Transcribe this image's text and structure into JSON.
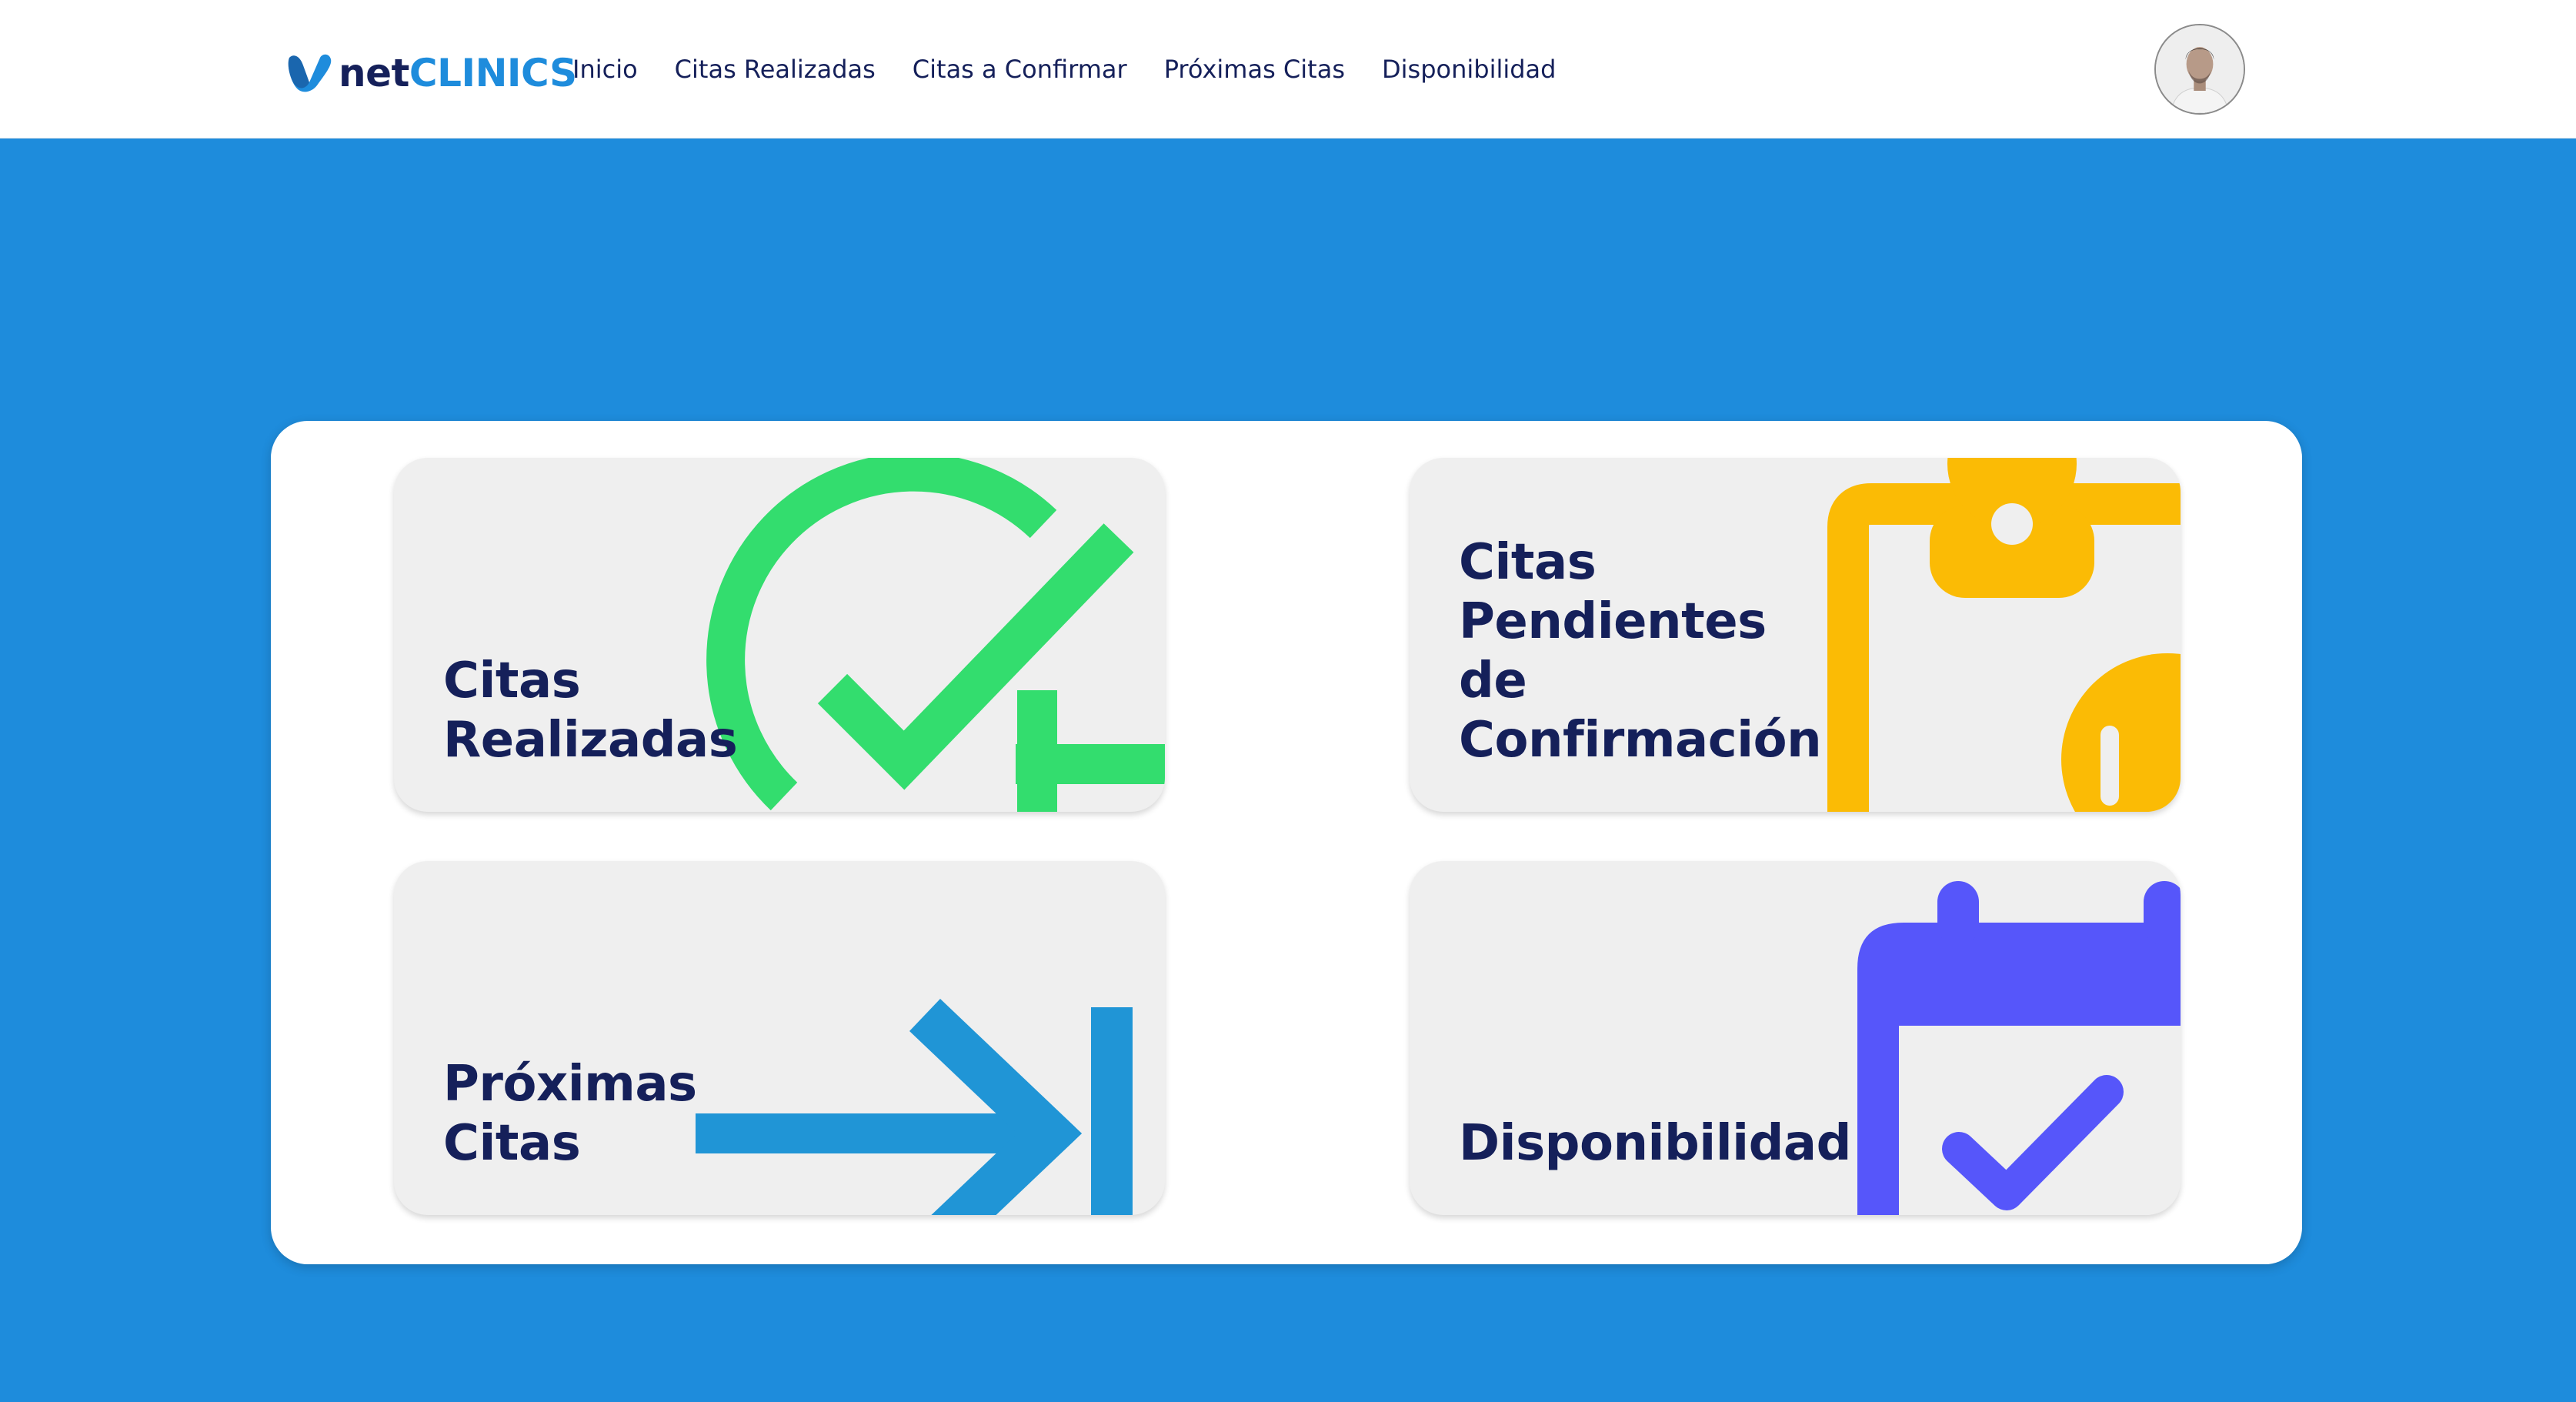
{
  "brand": {
    "name_part1": "net",
    "name_part2": "CLINICS",
    "colors": {
      "navy": "#15205a",
      "blue": "#1e8cdc"
    }
  },
  "nav": {
    "items": [
      {
        "label": "Inicio"
      },
      {
        "label": "Citas Realizadas"
      },
      {
        "label": "Citas a Confirmar"
      },
      {
        "label": "Próximas Citas"
      },
      {
        "label": "Disponibilidad"
      }
    ]
  },
  "user": {
    "avatar_icon": "user-avatar"
  },
  "cards": [
    {
      "title": "Citas\nRealizadas",
      "icon": "check-circle-plus-icon",
      "color": "#33dd6e"
    },
    {
      "title": "Citas\nPendientes\nde\nConfirmación",
      "icon": "clipboard-clock-icon",
      "color": "#fbbb05"
    },
    {
      "title": "Próximas\nCitas",
      "icon": "arrow-right-bar-icon",
      "color": "#2095d6"
    },
    {
      "title": "Disponibilidad",
      "icon": "calendar-check-icon",
      "color": "#5656fa"
    }
  ]
}
